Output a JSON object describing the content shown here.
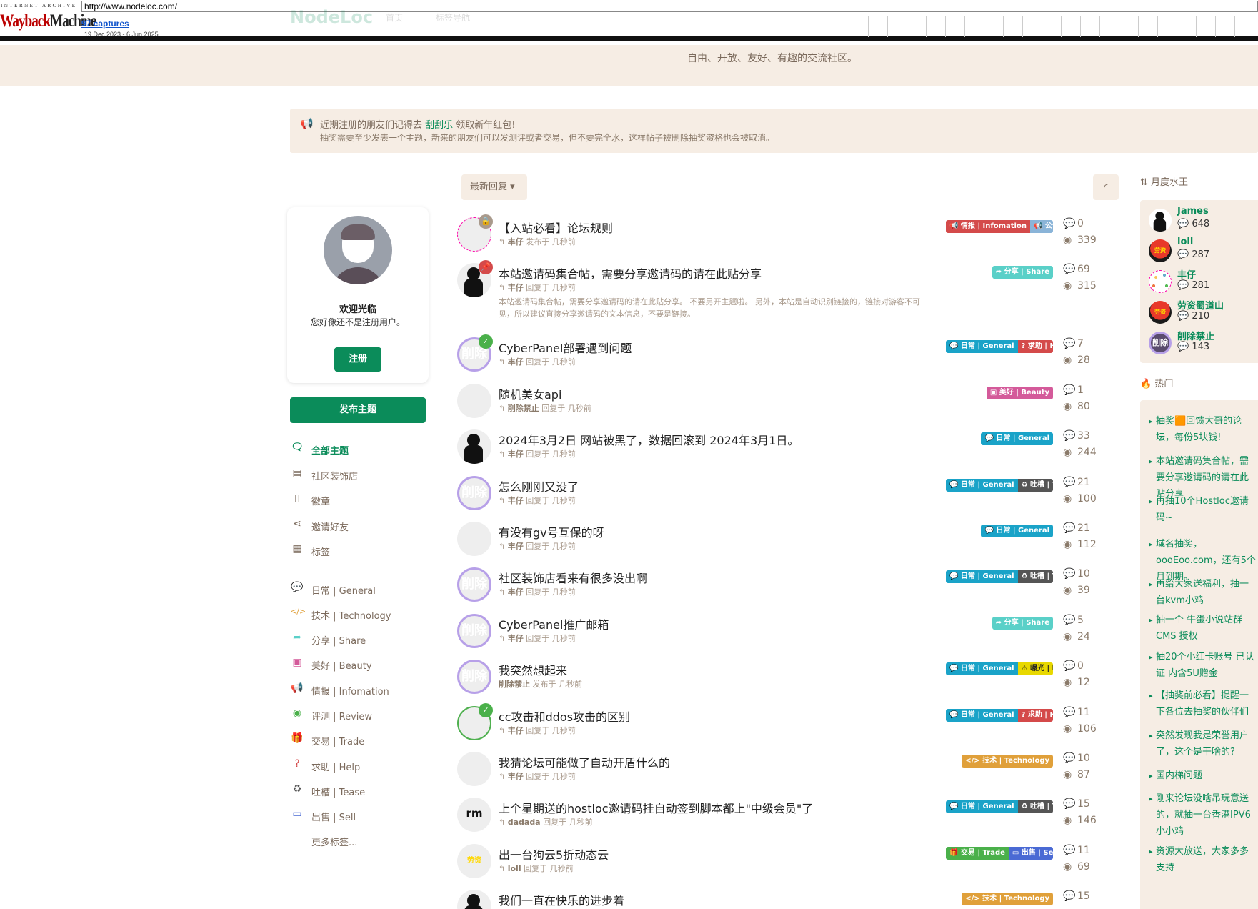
{
  "wayback": {
    "label_top": "INTERNET ARCHIVE",
    "logo_a": "Wayback",
    "logo_b": "Machine",
    "url": "http://www.nodeloc.com/",
    "captures": "97 captures",
    "range": "19 Dec 2023 - 6 Jun 2025"
  },
  "ghost": {
    "logo": "NodeLoc",
    "nav1": "首页",
    "nav2": "标签导航"
  },
  "hero": {
    "subtitle": "自由、开放、友好、有趣的交流社区。"
  },
  "notice": {
    "line1_before": "近期注册的朋友们记得去 ",
    "line1_link": "刮刮乐",
    "line1_after": " 领取新年红包!",
    "line2": "抽奖需要至少发表一个主题，新来的朋友们可以发测评或者交易，但不要完全水，这样帖子被删除抽奖资格也会被取消。"
  },
  "welcome": {
    "title": "欢迎光临",
    "subtitle": "您好像还不是注册用户。",
    "signup": "注册"
  },
  "post_button": "发布主题",
  "nav": [
    {
      "label": "全部主题",
      "icon": "comments-icon",
      "glyph": "🗨",
      "color": "#0b8c5a",
      "active": true
    },
    {
      "label": "社区装饰店",
      "icon": "store-icon",
      "glyph": "▤",
      "color": "#7b6a5c"
    },
    {
      "label": "徽章",
      "icon": "badge-icon",
      "glyph": "▯",
      "color": "#7b6a5c"
    },
    {
      "label": "邀请好友",
      "icon": "share-icon",
      "glyph": "⋖",
      "color": "#7b6a5c"
    },
    {
      "label": "标签",
      "icon": "tags-grid-icon",
      "glyph": "▦",
      "color": "#7b6a5c"
    }
  ],
  "tag_nav": [
    {
      "label": "日常 | General",
      "icon": "chat-icon",
      "glyph": "💬",
      "color": "#1aa3c8"
    },
    {
      "label": "技术 | Technology",
      "icon": "code-icon",
      "glyph": "</>",
      "color": "#e0a03a"
    },
    {
      "label": "分享 | Share",
      "icon": "share-arrow-icon",
      "glyph": "➦",
      "color": "#5ad0c8"
    },
    {
      "label": "美好 | Beauty",
      "icon": "image-icon",
      "glyph": "▣",
      "color": "#d45a9a"
    },
    {
      "label": "情报 | Infomation",
      "icon": "bullhorn-icon",
      "glyph": "📢",
      "color": "#d44a4a"
    },
    {
      "label": "评测 | Review",
      "icon": "eye-icon",
      "glyph": "◉",
      "color": "#4ab04a"
    },
    {
      "label": "交易 | Trade",
      "icon": "gift-icon",
      "glyph": "🎁",
      "color": "#4ab04a"
    },
    {
      "label": "求助 | Help",
      "icon": "question-icon",
      "glyph": "?",
      "color": "#d44a4a"
    },
    {
      "label": "吐槽 | Tease",
      "icon": "recycle-icon",
      "glyph": "♻",
      "color": "#555555"
    },
    {
      "label": "出售 | Sell",
      "icon": "shop-icon",
      "glyph": "▭",
      "color": "#4a6ad4"
    },
    {
      "label": "更多标签...",
      "icon": "",
      "glyph": "",
      "color": "#7b6a5c"
    }
  ],
  "controls": {
    "sort_label": "最新回复",
    "rss_icon": "rss-icon"
  },
  "discussions": [
    {
      "title": "【入站必看】论坛规则",
      "user": "丰仔",
      "action": "发布于 几秒前",
      "avatar": "av-dots",
      "badge": "lock",
      "tags": [
        {
          "text": "📢 情报 | Infomation",
          "color": "#d44a4a"
        },
        {
          "text": "📢 公告",
          "color": "#8ab4d8"
        }
      ],
      "replies": "0",
      "views": "339"
    },
    {
      "title": "本站邀请码集合帖，需要分享邀请码的请在此贴分享",
      "user": "丰仔",
      "action": "回复于 几秒前",
      "avatar": "av-sil",
      "badge": "pin",
      "excerpt": "本站邀请码集合帖，需要分享邀请码的请在此贴分享。 不要另开主题啦。 另外，本站是自动识别链接的，链接对游客不可见，所以建议直接分享邀请码的文本信息，不要是链接。",
      "tags": [
        {
          "text": "➦ 分享 | Share",
          "color": "#5ad0c8"
        }
      ],
      "replies": "69",
      "views": "315"
    },
    {
      "title": "CyberPanel部署遇到问题",
      "user": "丰仔",
      "action": "回复于 几秒前",
      "avatar": "av-del",
      "badge": "check",
      "tags": [
        {
          "text": "💬 日常 | General",
          "color": "#1aa3c8"
        },
        {
          "text": "? 求助 | Help",
          "color": "#d44a4a"
        }
      ],
      "replies": "7",
      "views": "28"
    },
    {
      "title": "随机美女api",
      "user": "削除禁止",
      "action": "回复于 几秒前",
      "avatar": "av-mosaic",
      "tags": [
        {
          "text": "▣ 美好 | Beauty",
          "color": "#d45a9a"
        }
      ],
      "replies": "1",
      "views": "80"
    },
    {
      "title": "2024年3月2日 网站被黑了，数据回滚到 2024年3月1日。",
      "user": "丰仔",
      "action": "回复于 几秒前",
      "avatar": "av-sil",
      "tags": [
        {
          "text": "💬 日常 | General",
          "color": "#1aa3c8"
        }
      ],
      "replies": "33",
      "views": "244"
    },
    {
      "title": "怎么刚刚又没了",
      "user": "丰仔",
      "action": "回复于 几秒前",
      "avatar": "av-del",
      "tags": [
        {
          "text": "💬 日常 | General",
          "color": "#1aa3c8"
        },
        {
          "text": "♻ 吐槽 | Tease",
          "color": "#555555"
        }
      ],
      "replies": "21",
      "views": "100"
    },
    {
      "title": "有没有gv号互保的呀",
      "user": "丰仔",
      "action": "回复于 几秒前",
      "avatar": "av-anime",
      "tags": [
        {
          "text": "💬 日常 | General",
          "color": "#1aa3c8"
        }
      ],
      "replies": "21",
      "views": "112"
    },
    {
      "title": "社区装饰店看来有很多没出啊",
      "user": "丰仔",
      "action": "回复于 几秒前",
      "avatar": "av-del",
      "tags": [
        {
          "text": "💬 日常 | General",
          "color": "#1aa3c8"
        },
        {
          "text": "♻ 吐槽 | Tease",
          "color": "#555555"
        }
      ],
      "replies": "10",
      "views": "39"
    },
    {
      "title": "CyberPanel推广邮箱",
      "user": "丰仔",
      "action": "回复于 几秒前",
      "avatar": "av-del",
      "tags": [
        {
          "text": "➦ 分享 | Share",
          "color": "#5ad0c8"
        }
      ],
      "replies": "5",
      "views": "24"
    },
    {
      "title": "我突然想起来",
      "user": "削除禁止",
      "action": "发布于 几秒前",
      "avatar": "av-del",
      "noreply": true,
      "tags": [
        {
          "text": "💬 日常 | General",
          "color": "#1aa3c8"
        },
        {
          "text": "⚠ 曝光 | Exposure",
          "color": "#e8d800"
        }
      ],
      "replies": "0",
      "views": "12"
    },
    {
      "title": "cc攻击和ddos攻击的区别",
      "user": "丰仔",
      "action": "回复于 几秒前",
      "avatar": "av-pink",
      "badge": "check",
      "tags": [
        {
          "text": "💬 日常 | General",
          "color": "#1aa3c8"
        },
        {
          "text": "? 求助 | Help",
          "color": "#d44a4a"
        }
      ],
      "replies": "11",
      "views": "106"
    },
    {
      "title": "我猜论坛可能做了自动开盾什么的",
      "user": "丰仔",
      "action": "回复于 几秒前",
      "avatar": "av-mosaic",
      "tags": [
        {
          "text": "</> 技术 | Technology",
          "color": "#e0a03a"
        }
      ],
      "replies": "10",
      "views": "87"
    },
    {
      "title": "上个星期送的hostloc邀请码挂自动签到脚本都上\"中级会员\"了",
      "user": "dadada",
      "action": "回复于 几秒前",
      "avatar": "av-rm",
      "avatar_text": "rm",
      "tags": [
        {
          "text": "💬 日常 | General",
          "color": "#1aa3c8"
        },
        {
          "text": "♻ 吐槽 | Tease",
          "color": "#555555"
        }
      ],
      "replies": "15",
      "views": "146"
    },
    {
      "title": "出一台狗云5折动态云",
      "user": "loll",
      "action": "回复于 几秒前",
      "avatar": "av-red",
      "tags": [
        {
          "text": "🎁 交易 | Trade",
          "color": "#4ab04a"
        },
        {
          "text": "▭ 出售 | Sell",
          "color": "#4a6ad4"
        }
      ],
      "replies": "11",
      "views": "69"
    },
    {
      "title": "我们一直在快乐的进步着",
      "user": "丰仔",
      "action": "回复于 几秒前",
      "avatar": "av-sil",
      "tags": [
        {
          "text": "</> 技术 | Technology",
          "color": "#e0a03a"
        }
      ],
      "replies": "15",
      "views": ""
    }
  ],
  "monthly": {
    "title": "月度水王",
    "users": [
      {
        "name": "James",
        "count": "648",
        "avatar": "av-sil"
      },
      {
        "name": "loll",
        "count": "287",
        "avatar": "av-red"
      },
      {
        "name": "丰仔",
        "count": "281",
        "avatar": "av-dots"
      },
      {
        "name": "劳资蜀道山",
        "count": "210",
        "avatar": "av-red"
      },
      {
        "name": "削除禁止",
        "count": "143",
        "avatar": "av-del"
      }
    ]
  },
  "hot": {
    "title": "热门",
    "items": [
      "抽奖🟧回馈大哥的论坛，每份5块钱!",
      "本站邀请码集合帖，需要分享邀请码的请在此贴分享",
      "再抽10个Hostloc邀请码~",
      "域名抽奖，oooEoo.com，还有5个月到期。",
      "再给大家送福利，抽一台kvm小鸡",
      "抽一个 牛蛋小说站群CMS 授权",
      "抽20个小红卡账号 已认证 内含5U赠金",
      "【抽奖前必看】提醒一下各位去抽奖的伙伴们",
      "突然发现我是荣誉用户了，这个是干啥的?",
      "国内梯问题",
      "刚来论坛没啥吊玩意送的，就抽一台香港IPV6小小鸡",
      "资源大放送，大家多多支持"
    ]
  }
}
